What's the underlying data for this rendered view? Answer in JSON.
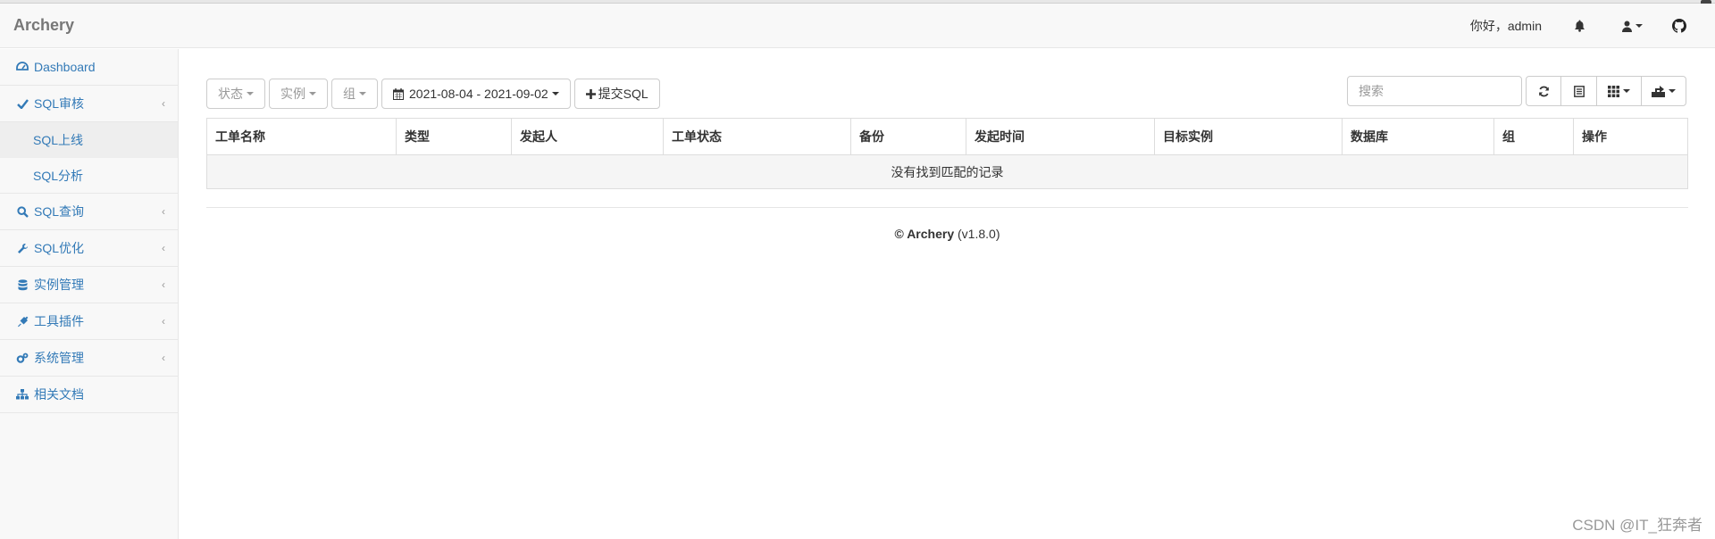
{
  "app": {
    "brand": "Archery"
  },
  "navbar": {
    "greeting": "你好，admin"
  },
  "sidebar": {
    "items": [
      {
        "label": "Dashboard",
        "icon": "dashboard-icon",
        "has_arrow": false
      },
      {
        "label": "SQL审核",
        "icon": "check-icon",
        "has_arrow": true
      },
      {
        "label": "SQL查询",
        "icon": "search-icon",
        "has_arrow": true
      },
      {
        "label": "SQL优化",
        "icon": "wrench-icon",
        "has_arrow": true
      },
      {
        "label": "实例管理",
        "icon": "database-icon",
        "has_arrow": true
      },
      {
        "label": "工具插件",
        "icon": "plug-icon",
        "has_arrow": true
      },
      {
        "label": "系统管理",
        "icon": "gears-icon",
        "has_arrow": true
      },
      {
        "label": "相关文档",
        "icon": "sitemap-icon",
        "has_arrow": false
      }
    ],
    "sub_items": [
      {
        "label": "SQL上线",
        "active": true
      },
      {
        "label": "SQL分析",
        "active": false
      }
    ]
  },
  "toolbar": {
    "status_filter": "状态",
    "instance_filter": "实例",
    "group_filter": "组",
    "date_range": "2021-08-04 - 2021-09-02",
    "submit_label": "提交SQL",
    "search_placeholder": "搜索"
  },
  "table": {
    "columns": [
      "工单名称",
      "类型",
      "发起人",
      "工单状态",
      "备份",
      "发起时间",
      "目标实例",
      "数据库",
      "组",
      "操作"
    ],
    "empty_text": "没有找到匹配的记录"
  },
  "footer": {
    "copyright": "© Archery",
    "version": "(v1.8.0)"
  },
  "watermark": "CSDN @IT_狂奔者",
  "colors": {
    "link": "#337ab7",
    "navbar_bg": "#f8f8f8",
    "border": "#dddddd"
  }
}
